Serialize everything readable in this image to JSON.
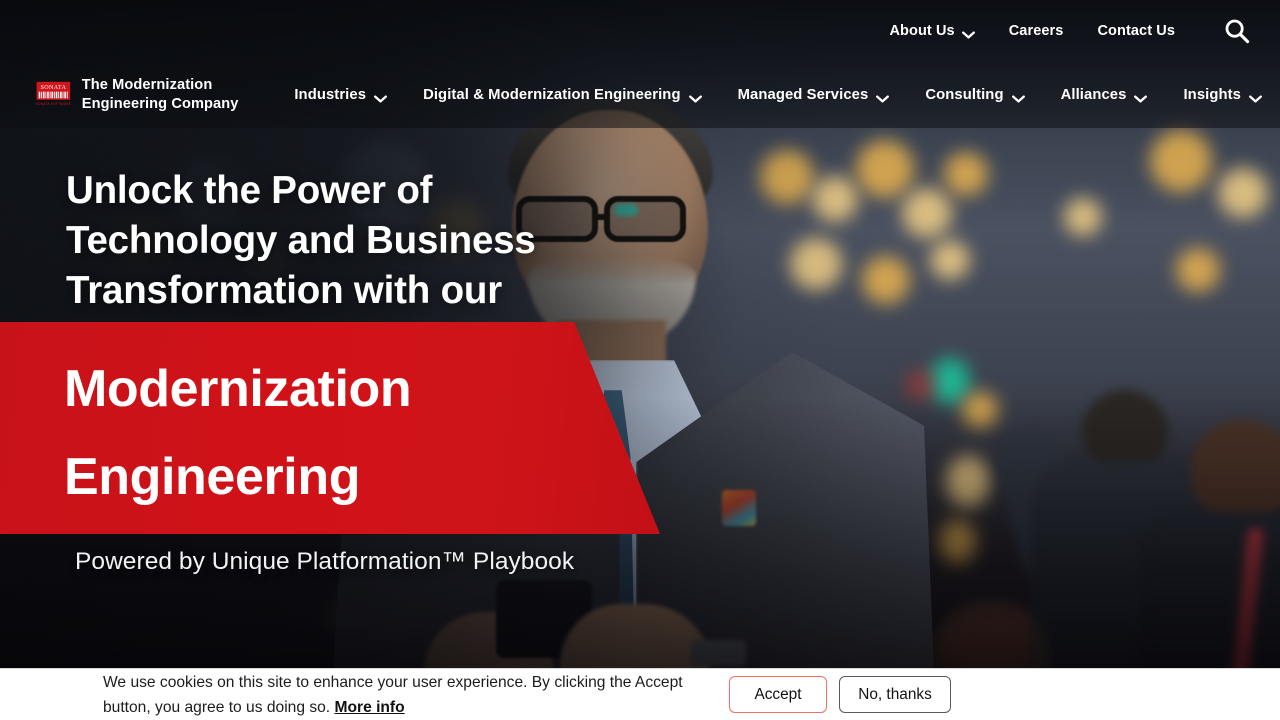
{
  "header": {
    "utility_nav": [
      {
        "label": "About Us",
        "has_chevron": true,
        "icon": "chevron-down-icon"
      },
      {
        "label": "Careers",
        "has_chevron": false,
        "icon": ""
      },
      {
        "label": "Contact Us",
        "has_chevron": false,
        "icon": ""
      }
    ],
    "search_icon": "search-icon",
    "brand": {
      "logo_text": "SONATA",
      "logo_subtext": "SONATA SOFTWARE",
      "logo_color": "#D0161C",
      "tagline": "The Modernization Engineering Company"
    },
    "main_nav": [
      {
        "label": "Industries",
        "has_chevron": true
      },
      {
        "label": "Digital & Modernization Engineering",
        "has_chevron": true
      },
      {
        "label": "Managed Services",
        "has_chevron": true
      },
      {
        "label": "Consulting",
        "has_chevron": true
      },
      {
        "label": "Alliances",
        "has_chevron": true
      },
      {
        "label": "Insights",
        "has_chevron": true
      }
    ]
  },
  "hero": {
    "headline": "Unlock the Power of Technology and Business Transformation with our",
    "highlight_line1": "Modernization",
    "highlight_line2": "Engineering",
    "highlight_bg_color": "#CF1319",
    "subline": "Powered by Unique Platformation™ Playbook"
  },
  "cookie_banner": {
    "text": "We use cookies on this site to enhance your user experience. By clicking the Accept button, you agree to us doing so.",
    "more_info_label": "More info",
    "accept_label": "Accept",
    "decline_label": "No, thanks",
    "accept_border_color": "#F0706A",
    "decline_border_color": "#555A5E"
  }
}
